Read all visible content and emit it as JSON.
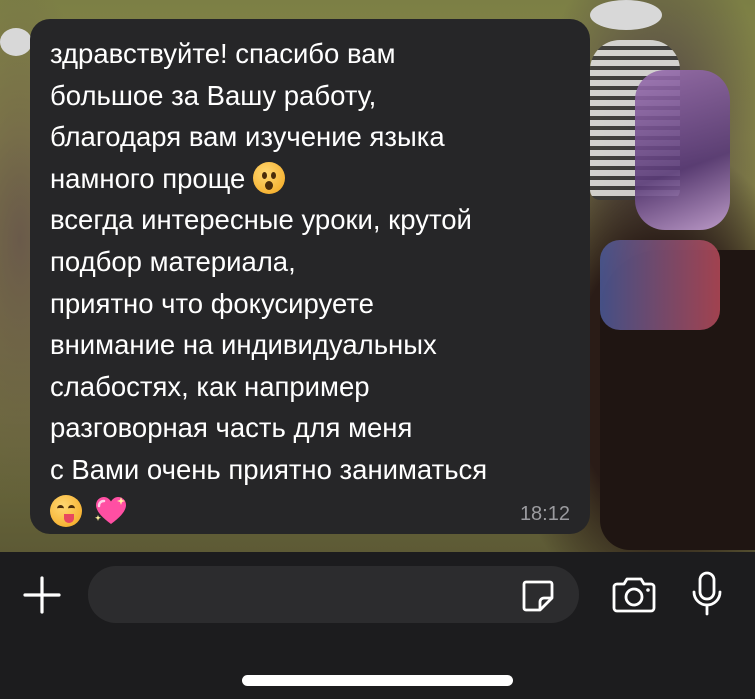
{
  "conversation": {
    "message": {
      "lines": [
        "здравствуйте! спасибо вам",
        "большое за Вашу работу,",
        "благодаря вам изучение языка",
        "намного проще",
        "всегда интересные уроки, крутой",
        "подбор материала,",
        "приятно что фокусируете",
        "внимание на индивидуальных",
        "слабостях, как например",
        "разговорная часть для меня",
        "с Вами очень приятно заниматься"
      ],
      "time": "18:12",
      "emojis": [
        "hushed-face-emoji",
        "face-savoring-food-emoji",
        "sparkling-heart-emoji"
      ]
    }
  },
  "composer": {
    "message_value": "",
    "icons": {
      "attach": "plus-icon",
      "sticker": "sticker-icon",
      "camera": "camera-icon",
      "mic": "microphone-icon"
    }
  },
  "colors": {
    "bubble": "#262628",
    "bar": "#1c1c1e",
    "field": "#2c2c2e",
    "text": "#ffffff",
    "timestamp": "#9b9b9f"
  }
}
